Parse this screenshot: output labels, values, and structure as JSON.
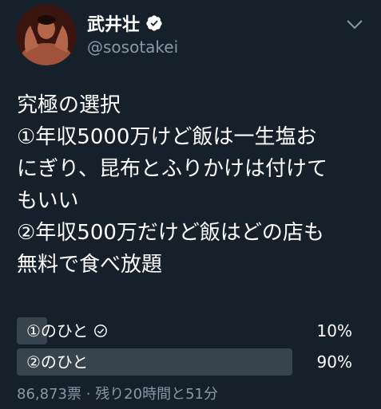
{
  "user": {
    "name": "武井壮",
    "handle": "@sosotakei"
  },
  "tweet": {
    "text": "究極の選択\n①年収5000万けど飯は一生塩お\nにぎり、昆布とふりかけは付けて\nもいい\n②年収500万だけど飯はどの店も\n無料で食べ放題"
  },
  "poll": {
    "options": [
      {
        "label": "①のひと",
        "percent_label": "10%",
        "percent": 10,
        "selected": true
      },
      {
        "label": "②のひと",
        "percent_label": "90%",
        "percent": 90,
        "selected": false
      }
    ],
    "votes_text": "86,873票",
    "separator": "·",
    "time_left_text": "残り20時間と51分"
  },
  "colors": {
    "background": "#15202b",
    "text": "#ffffff",
    "secondary_text": "#8899a6",
    "bar": "#38444d"
  },
  "icons": [
    "verified-badge-icon",
    "chevron-down-icon",
    "checkmark-circle-icon"
  ]
}
